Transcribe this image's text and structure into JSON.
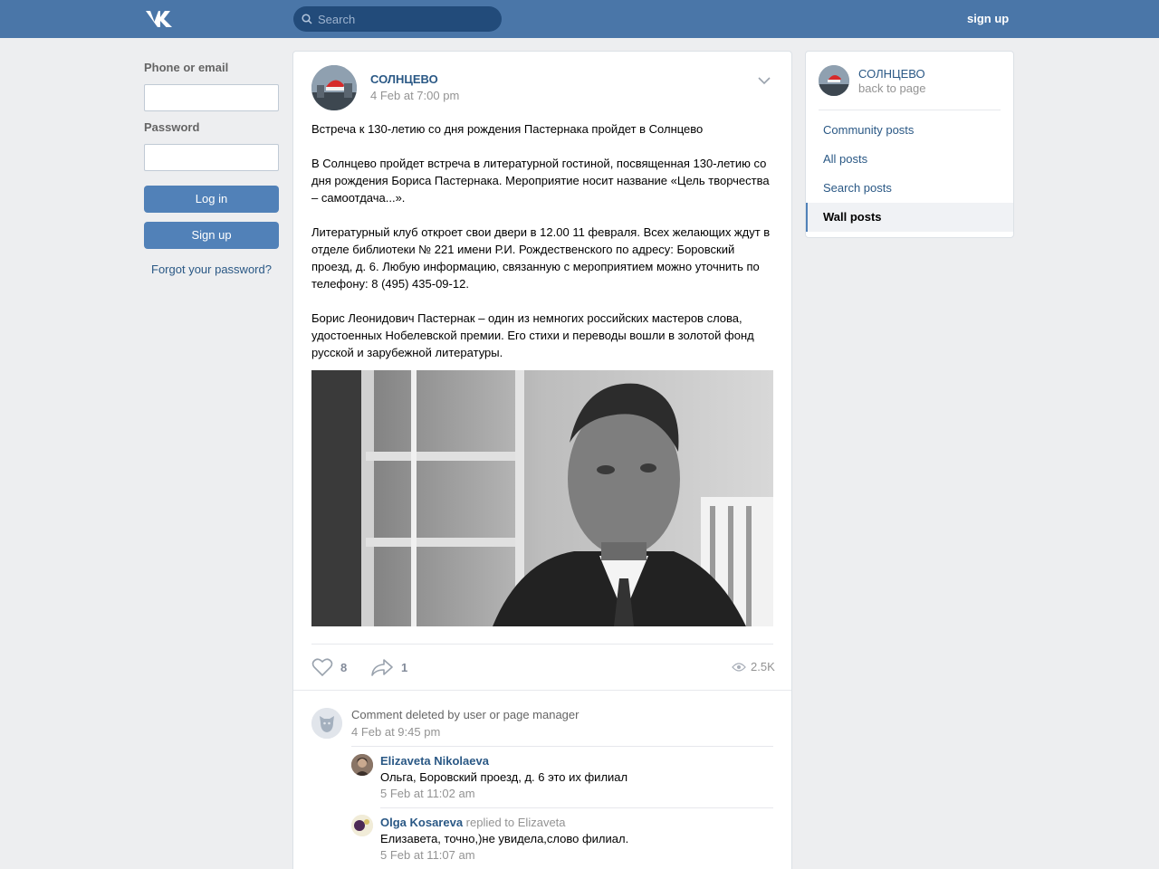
{
  "header": {
    "search_placeholder": "Search",
    "signup_label": "sign up"
  },
  "login": {
    "phone_label": "Phone or email",
    "password_label": "Password",
    "login_button": "Log in",
    "signup_button": "Sign up",
    "forgot_link": "Forgot your password?"
  },
  "post": {
    "author": "СОЛНЦЕВО",
    "date": "4 Feb at 7:00 pm",
    "paragraphs": [
      "Встреча к 130-летию со дня рождения Пастернака пройдет в Солнцево",
      "В Солнцево пройдет встреча в литературной гостиной, посвященная 130-летию со дня рождения Бориса Пастернака. Мероприятие носит название «Цель творчества – самоотдача...».",
      "Литературный клуб откроет свои двери в 12.00 11 февраля. Всех желающих ждут в отделе библиотеки № 221 имени Р.И. Рождественского по адресу: Боровский проезд, д. 6. Любую информацию, связанную с мероприятием можно уточнить по телефону: 8 (495) 435-09-12.",
      "Борис Леонидович Пастернак – один из немногих российских мастеров слова, удостоенных Нобелевской премии. Его стихи и переводы вошли в золотой фонд русской и зарубежной литературы."
    ],
    "likes": "8",
    "shares": "1",
    "views": "2.5K"
  },
  "comments": [
    {
      "text": "Comment deleted by user or page manager",
      "date": "4 Feb at 9:45 pm"
    },
    {
      "author": "Elizaveta Nikolaeva",
      "text": "Ольга, Боровский проезд, д. 6 это их филиал",
      "date": "5 Feb at 11:02 am"
    },
    {
      "author": "Olga Kosareva",
      "replied": "replied to Elizaveta",
      "text": "Елизавета, точно,)не увидела,слово филиал.",
      "date": "5 Feb at 11:07 am"
    }
  ],
  "sidebar": {
    "name": "СОЛНЦЕВО",
    "back": "back to page",
    "items": [
      {
        "label": "Community posts",
        "active": false
      },
      {
        "label": "All posts",
        "active": false
      },
      {
        "label": "Search posts",
        "active": false
      },
      {
        "label": "Wall posts",
        "active": true
      }
    ]
  },
  "colors": {
    "header": "#4a76a8",
    "link": "#2a5885",
    "button": "#5181b8",
    "background": "#edeef0"
  },
  "icons": [
    "vk-logo",
    "search-icon",
    "chevron-down-icon",
    "heart-icon",
    "share-icon",
    "eye-icon",
    "default-avatar-dog-icon"
  ]
}
